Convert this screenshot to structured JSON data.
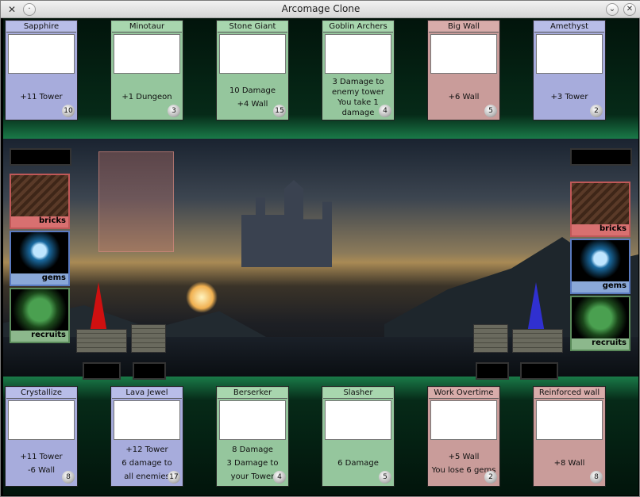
{
  "window": {
    "title": "Arcomage Clone"
  },
  "colors": {
    "blue_card": "#a7acdc",
    "green_card": "#95c69d",
    "red_card": "#c99c9a",
    "player_tower": "#d01010",
    "enemy_tower": "#3030d0"
  },
  "top_cards": [
    {
      "name": "Sapphire",
      "lines": [
        "+11 Tower"
      ],
      "cost": "10",
      "color": "blue"
    },
    {
      "name": "Minotaur",
      "lines": [
        "+1 Dungeon"
      ],
      "cost": "3",
      "color": "green"
    },
    {
      "name": "Stone Giant",
      "lines": [
        "10 Damage",
        "+4 Wall"
      ],
      "cost": "15",
      "color": "green"
    },
    {
      "name": "Goblin Archers",
      "lines": [
        "3 Damage to",
        "enemy tower",
        "You take 1",
        "damage"
      ],
      "cost": "4",
      "color": "green"
    },
    {
      "name": "Big Wall",
      "lines": [
        "+6 Wall"
      ],
      "cost": "5",
      "color": "red"
    },
    {
      "name": "Amethyst",
      "lines": [
        "+3 Tower"
      ],
      "cost": "2",
      "color": "blue"
    }
  ],
  "bottom_cards": [
    {
      "name": "Crystallize",
      "lines": [
        "+11 Tower",
        "-6 Wall"
      ],
      "cost": "8",
      "color": "blue"
    },
    {
      "name": "Lava Jewel",
      "lines": [
        "+12 Tower",
        "6 damage to",
        "all enemies"
      ],
      "cost": "17",
      "color": "blue"
    },
    {
      "name": "Berserker",
      "lines": [
        "8 Damage",
        "3 Damage to",
        "your Tower"
      ],
      "cost": "4",
      "color": "green"
    },
    {
      "name": "Slasher",
      "lines": [
        "6 Damage"
      ],
      "cost": "5",
      "color": "green"
    },
    {
      "name": "Work Overtime",
      "lines": [
        "+5 Wall",
        "You lose 6 gems"
      ],
      "cost": "2",
      "color": "red"
    },
    {
      "name": "Reinforced wall",
      "lines": [
        "+8 Wall"
      ],
      "cost": "8",
      "color": "red"
    }
  ],
  "left_resources": [
    {
      "label": "bricks"
    },
    {
      "label": "gems"
    },
    {
      "label": "recruits"
    }
  ],
  "right_resources": [
    {
      "label": "bricks"
    },
    {
      "label": "gems"
    },
    {
      "label": "recruits"
    }
  ]
}
